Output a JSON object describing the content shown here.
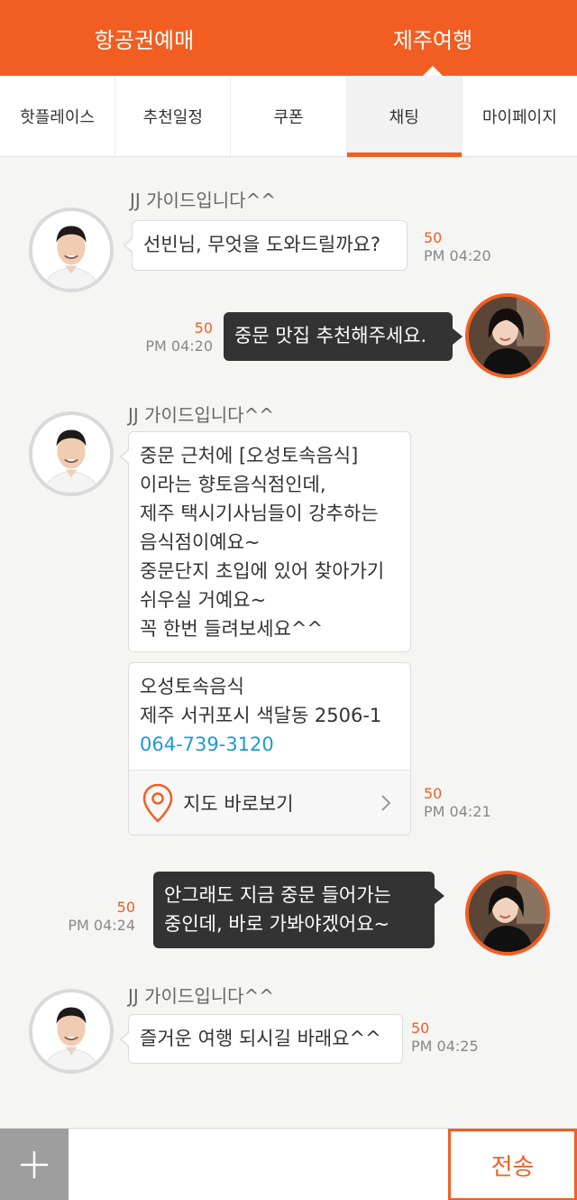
{
  "header": {
    "tabs": [
      {
        "label": "항공권예매"
      },
      {
        "label": "제주여행"
      }
    ]
  },
  "subnav": {
    "tabs": [
      {
        "label": "핫플레이스"
      },
      {
        "label": "추천일정"
      },
      {
        "label": "쿠폰"
      },
      {
        "label": "채팅"
      },
      {
        "label": "마이페이지"
      }
    ]
  },
  "chat": {
    "guide_name": "JJ 가이드입니다^^",
    "messages": [
      {
        "sender": "JJ 가이드입니다^^",
        "text": "선빈님, 무엇을 도와드릴까요?",
        "count": "50",
        "time": "PM  04:20"
      },
      {
        "text": "중문 맛집 추천해주세요.",
        "count": "50",
        "time": "PM  04:20"
      },
      {
        "sender": "JJ 가이드입니다^^",
        "lines": [
          "중문 근처에  [오성토속음식]",
          "이라는 향토음식점인데,",
          "제주 택시기사님들이 강추하는",
          "음식점이예요~",
          "중문단지 초입에 있어 찾아가기",
          "쉬우실 거예요~",
          "꼭 한번 들려보세요^^"
        ]
      },
      {
        "card": {
          "name": "오성토속음식",
          "address": "제주 서귀포시 색달동 2506-1",
          "phone": "064-739-3120",
          "map_label": "지도 바로보기"
        },
        "count": "50",
        "time": "PM  04:21"
      },
      {
        "lines": [
          "안그래도 지금 중문 들어가는",
          "중인데, 바로 가봐야겠어요~"
        ],
        "count": "50",
        "time": "PM  04:24"
      },
      {
        "sender": "JJ 가이드입니다^^",
        "text": "즐거운 여행 되시길 바래요^^",
        "count": "50",
        "time": "PM  04:25"
      }
    ]
  },
  "composer": {
    "placeholder": "",
    "send_label": "전송"
  },
  "icons": {
    "plus": "plus-icon",
    "pin": "map-pin-icon",
    "chevron": "chevron-right-icon"
  },
  "colors": {
    "accent": "#f25e22",
    "link": "#1b9ad6",
    "dark_bubble": "#333333"
  }
}
